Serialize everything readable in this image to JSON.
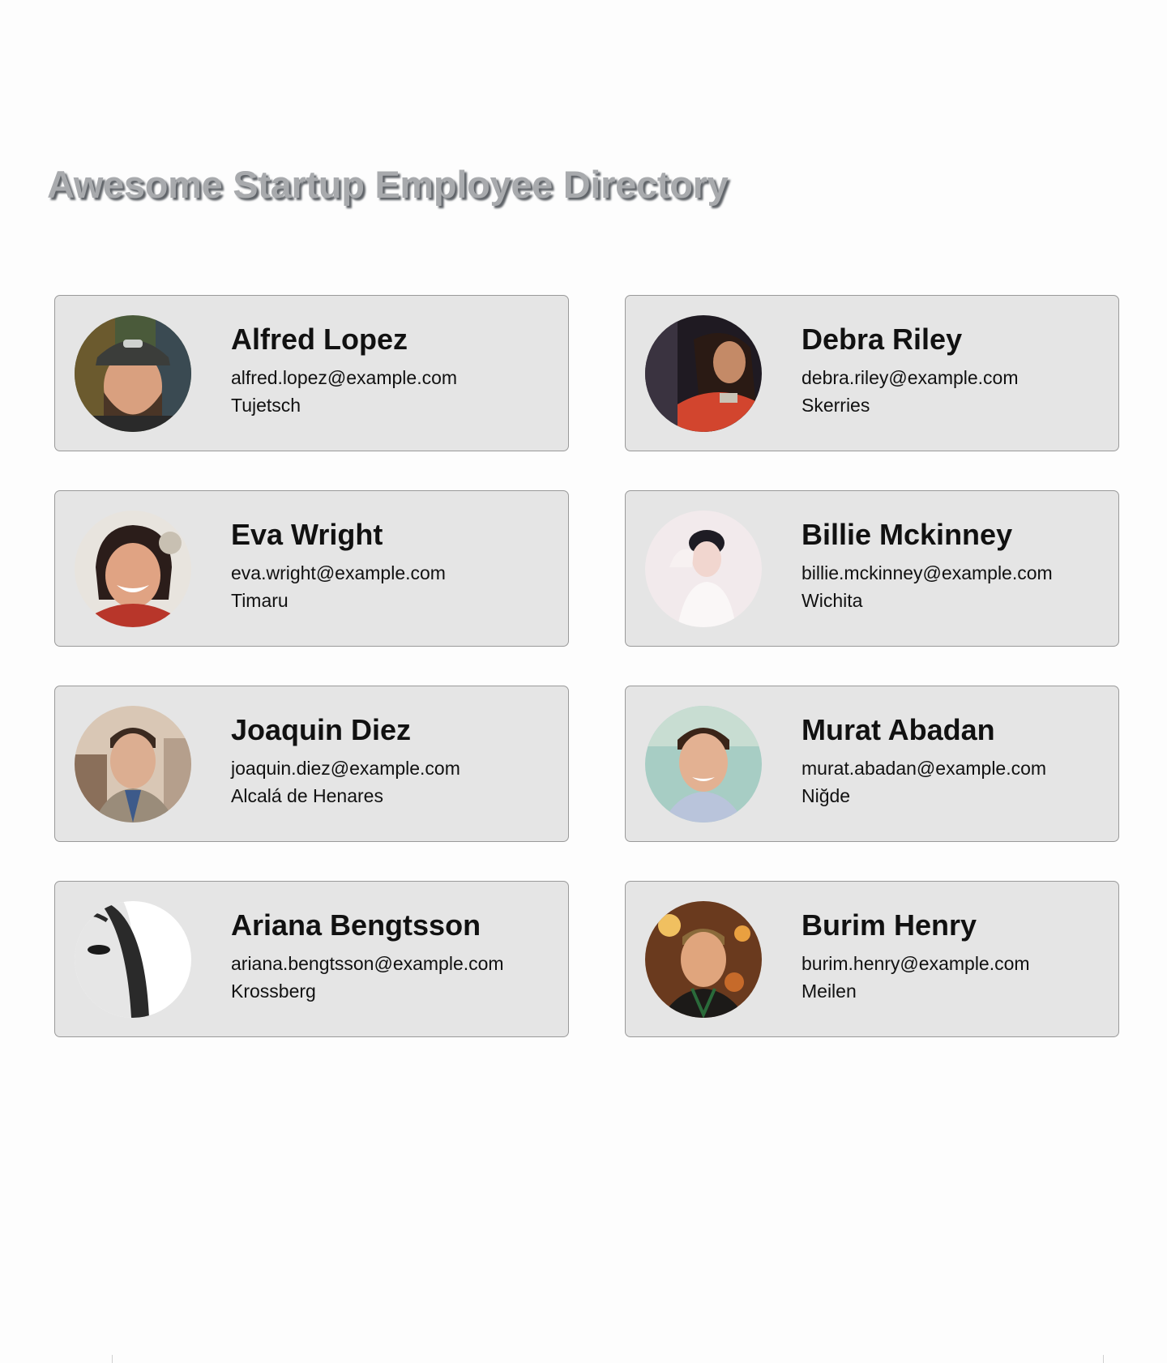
{
  "header": {
    "title": "Awesome Startup Employee Directory"
  },
  "employees": [
    {
      "name": "Alfred Lopez",
      "email": "alfred.lopez@example.com",
      "city": "Tujetsch"
    },
    {
      "name": "Debra Riley",
      "email": "debra.riley@example.com",
      "city": "Skerries"
    },
    {
      "name": "Eva Wright",
      "email": "eva.wright@example.com",
      "city": "Timaru"
    },
    {
      "name": "Billie Mckinney",
      "email": "billie.mckinney@example.com",
      "city": "Wichita"
    },
    {
      "name": "Joaquin Diez",
      "email": "joaquin.diez@example.com",
      "city": "Alcalá de Henares"
    },
    {
      "name": "Murat Abadan",
      "email": "murat.abadan@example.com",
      "city": "Niğde"
    },
    {
      "name": "Ariana Bengtsson",
      "email": "ariana.bengtsson@example.com",
      "city": "Krossberg"
    },
    {
      "name": "Burim Henry",
      "email": "burim.henry@example.com",
      "city": "Meilen"
    }
  ]
}
